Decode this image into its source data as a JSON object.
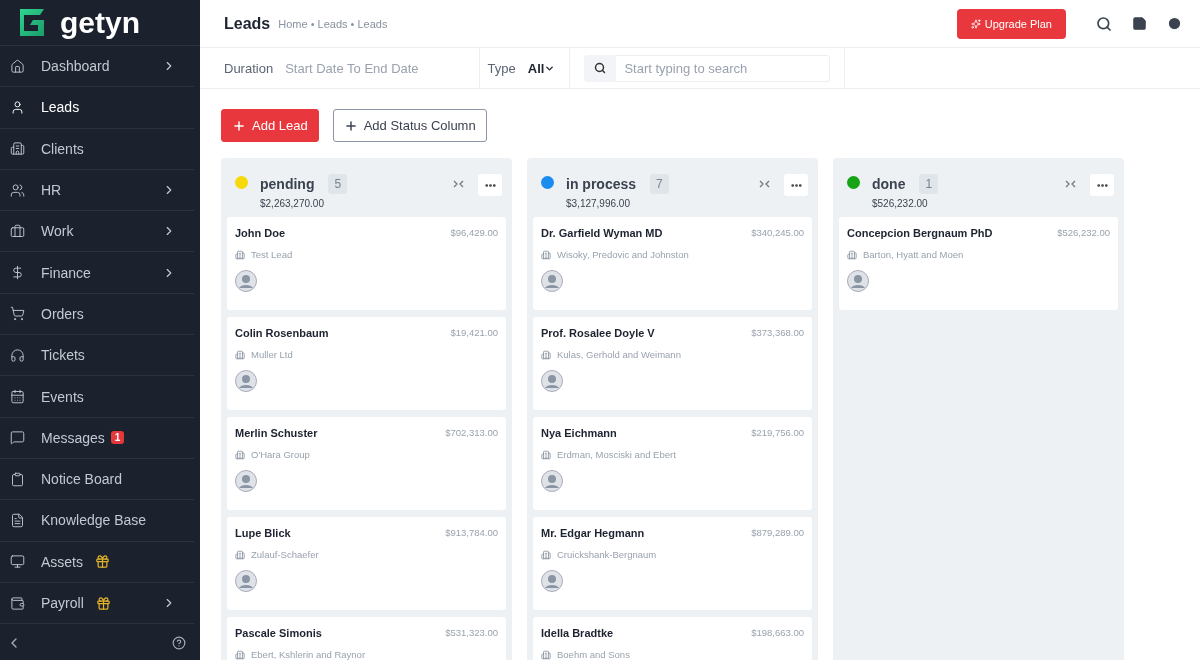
{
  "brand": {
    "name": "getyn"
  },
  "sidebar": {
    "items": [
      {
        "label": "Dashboard",
        "selected": false,
        "submenu": true,
        "gift": false
      },
      {
        "label": "Leads",
        "selected": true,
        "submenu": false,
        "gift": false
      },
      {
        "label": "Clients",
        "selected": false,
        "submenu": false,
        "gift": false
      },
      {
        "label": "HR",
        "selected": false,
        "submenu": true,
        "gift": false
      },
      {
        "label": "Work",
        "selected": false,
        "submenu": true,
        "gift": false
      },
      {
        "label": "Finance",
        "selected": false,
        "submenu": true,
        "gift": false
      },
      {
        "label": "Orders",
        "selected": false,
        "submenu": false,
        "gift": false
      },
      {
        "label": "Tickets",
        "selected": false,
        "submenu": false,
        "gift": false
      },
      {
        "label": "Events",
        "selected": false,
        "submenu": false,
        "gift": false
      },
      {
        "label": "Messages",
        "selected": false,
        "submenu": false,
        "gift": false,
        "badge": "1"
      },
      {
        "label": "Notice Board",
        "selected": false,
        "submenu": false,
        "gift": false
      },
      {
        "label": "Knowledge Base",
        "selected": false,
        "submenu": false,
        "gift": false
      },
      {
        "label": "Assets",
        "selected": false,
        "submenu": false,
        "gift": true
      },
      {
        "label": "Payroll",
        "selected": false,
        "submenu": true,
        "gift": true
      }
    ]
  },
  "header": {
    "title": "Leads",
    "breadcrumb": "Home • Leads • Leads",
    "upgrade_button": "Upgrade Plan"
  },
  "filters": {
    "duration_label": "Duration",
    "duration_placeholder": "Start Date To End Date",
    "type_label": "Type",
    "type_value": "All",
    "search_placeholder": "Start typing to search"
  },
  "actions": [
    "Add Lead",
    "Add Status Column"
  ],
  "columns": [
    {
      "name": "pending",
      "count": "5",
      "total": "$2,263,270.00",
      "color": "#f5d90a",
      "cards": [
        {
          "name": "John Doe",
          "amount": "$96,429.00",
          "company": "Test Lead",
          "avatar": true
        },
        {
          "name": "Colin Rosenbaum",
          "amount": "$19,421.00",
          "company": "Muller Ltd",
          "avatar": true
        },
        {
          "name": "Merlin Schuster",
          "amount": "$702,313.00",
          "company": "O'Hara Group",
          "avatar": true
        },
        {
          "name": "Lupe Blick",
          "amount": "$913,784.00",
          "company": "Zulauf-Schaefer",
          "avatar": true
        },
        {
          "name": "Pascale Simonis",
          "amount": "$531,323.00",
          "company": "Ebert, Kshlerin and Raynor",
          "avatar": false
        }
      ]
    },
    {
      "name": "in process",
      "count": "7",
      "total": "$3,127,996.00",
      "color": "#1a8cf0",
      "cards": [
        {
          "name": "Dr. Garfield Wyman MD",
          "amount": "$340,245.00",
          "company": "Wisoky, Predovic and Johnston",
          "avatar": true
        },
        {
          "name": "Prof. Rosalee Doyle V",
          "amount": "$373,368.00",
          "company": "Kulas, Gerhold and Weimann",
          "avatar": true
        },
        {
          "name": "Nya Eichmann",
          "amount": "$219,756.00",
          "company": "Erdman, Mosciski and Ebert",
          "avatar": true
        },
        {
          "name": "Mr. Edgar Hegmann",
          "amount": "$879,289.00",
          "company": "Cruickshank-Bergnaum",
          "avatar": true
        },
        {
          "name": "Idella Bradtke",
          "amount": "$198,663.00",
          "company": "Boehm and Sons",
          "avatar": false
        }
      ]
    },
    {
      "name": "done",
      "count": "1",
      "total": "$526,232.00",
      "color": "#16a316",
      "cards": [
        {
          "name": "Concepcion Bergnaum PhD",
          "amount": "$526,232.00",
          "company": "Barton, Hyatt and Moen",
          "avatar": true
        }
      ]
    }
  ]
}
